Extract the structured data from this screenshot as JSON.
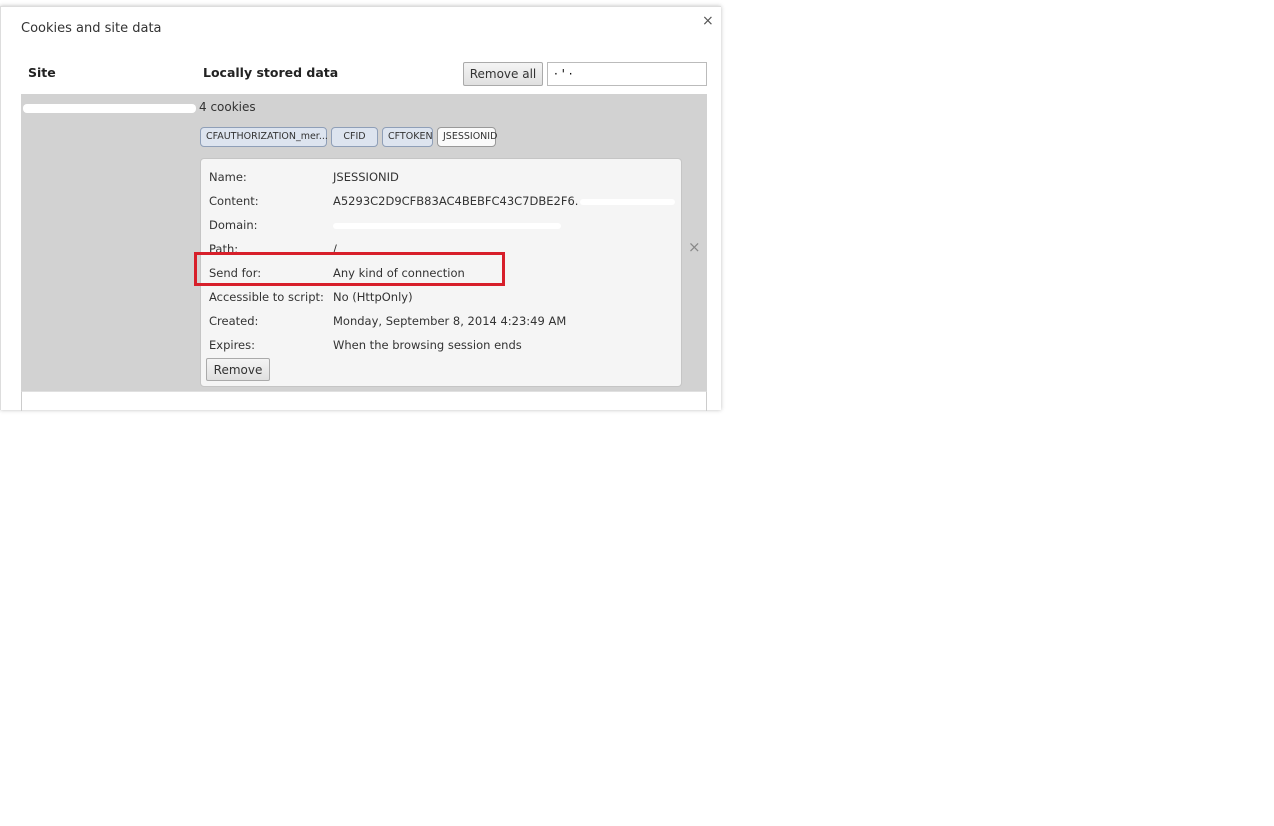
{
  "dialog": {
    "title": "Cookies and site data",
    "close_glyph": "×"
  },
  "header": {
    "site_label": "Site",
    "data_label": "Locally stored data",
    "remove_all_label": "Remove all",
    "search_value": "· ' ·"
  },
  "site": {
    "cookie_count": "4 cookies",
    "close_glyph": "×",
    "cookies": [
      {
        "label": "CFAUTHORIZATION_mer..."
      },
      {
        "label": "CFID"
      },
      {
        "label": "CFTOKEN"
      },
      {
        "label": "JSESSIONID"
      }
    ]
  },
  "details": {
    "name_label": "Name:",
    "name_value": "JSESSIONID",
    "content_label": "Content:",
    "content_value": "A5293C2D9CFB83AC4BEBFC43C7DBE2F6.",
    "domain_label": "Domain:",
    "path_label": "Path:",
    "path_value": "/",
    "sendfor_label": "Send for:",
    "sendfor_value": "Any kind of connection",
    "script_label": "Accessible to script:",
    "script_value": "No (HttpOnly)",
    "created_label": "Created:",
    "created_value": "Monday, September 8, 2014 4:23:49 AM",
    "expires_label": "Expires:",
    "expires_value": "When the browsing session ends",
    "remove_label": "Remove"
  },
  "colors": {
    "highlight": "#d71f2a",
    "row_selected": "#d2d2d2",
    "chip_bg": "#dde4ef"
  }
}
